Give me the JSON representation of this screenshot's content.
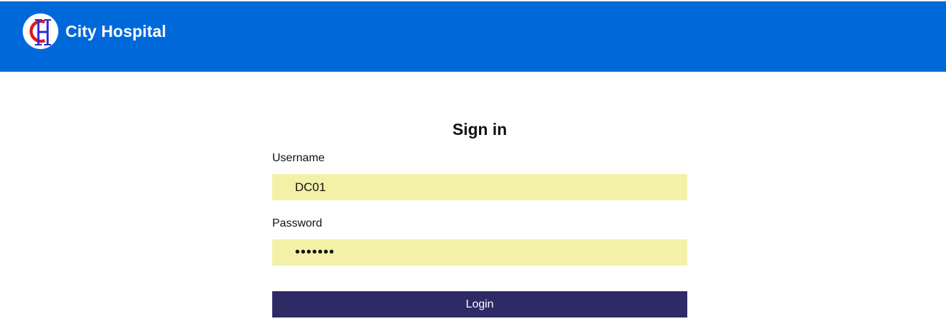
{
  "header": {
    "brand_title": "City Hospital",
    "background_color": "#0069d9",
    "logo_icon": "city-hospital-logo-icon"
  },
  "signin": {
    "title": "Sign in",
    "username_label": "Username",
    "username_value": "DC01",
    "password_label": "Password",
    "password_value": "1234567",
    "input_background_color": "#f3f1a7",
    "login_label": "Login",
    "login_button_color": "#2d2a66"
  }
}
